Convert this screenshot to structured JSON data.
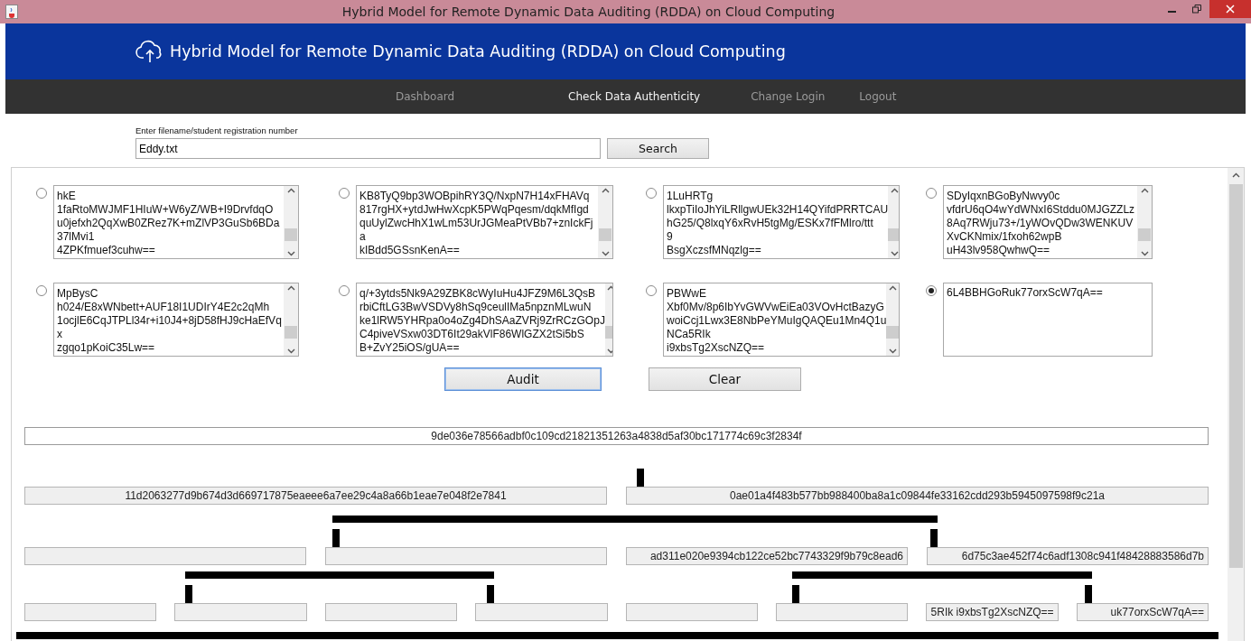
{
  "window": {
    "title": "Hybrid Model for Remote Dynamic Data Auditing (RDDA) on Cloud Computing"
  },
  "header": {
    "title": "Hybrid Model for Remote Dynamic Data Auditing (RDDA) on Cloud Computing"
  },
  "nav": [
    {
      "label": "Dashboard",
      "selected": false
    },
    {
      "label": "Check Data Authenticity",
      "selected": true
    },
    {
      "label": "Change Login",
      "selected": false
    },
    {
      "label": "Logout",
      "selected": false
    }
  ],
  "search": {
    "label": "Enter filename/student registration number",
    "value": "Eddy.txt",
    "button": "Search"
  },
  "blocks": [
    {
      "selected": false,
      "scrollable": true,
      "lines": [
        "hkE",
        "1faRtoMWJMF1HIuW+W6yZ/WB+I9DrvfdqO",
        "u0jefxh2QqXwB0ZRez7K+mZlVP3GuSb6BDa",
        "37lMvi1",
        "4ZPKfmuef3cuhw=="
      ]
    },
    {
      "selected": false,
      "scrollable": true,
      "lines": [
        "KB8TyQ9bp3WOBpihRY3Q/NxpN7H14xFHAVq",
        "817rgHX+ytdJwHwXcpK5PWqPqesm/dqkMfIgd",
        "quUylZwcHhX1wLm53UrJGMeaPtVBb7+znIckFj",
        "a",
        "kIBdd5GSsnKenA=="
      ]
    },
    {
      "selected": false,
      "scrollable": true,
      "lines": [
        "1LuHRTg",
        "lkxpTiIoJhYiLRllgwUEk32H14QYifdPRRTCAU",
        "hG25/Q8lxqY6xRvH5tgMg/ESKx7fFMlro/ttt",
        "9",
        "BsgXczsfMNqzlg=="
      ]
    },
    {
      "selected": false,
      "scrollable": true,
      "lines": [
        "SDyIqxnBGoByNwvy0c",
        "vfdrU6qO4wYdWNxI6Stddu0MJGZZLz",
        "8Aq7RWju73+/1yWOvQDw3WENKUV",
        "XvCKNmix/1fxoh62wpB",
        "uH43lv958QwhwQ=="
      ]
    },
    {
      "selected": false,
      "scrollable": true,
      "lines": [
        "MpBysC",
        "h024/E8xWNbett+AUF18I1UDIrY4E2c2qMh",
        "1ocjlE6CqJTPLl34r+i10J4+8jD58fHJ9cHaEfVq",
        "x",
        "zgqo1pKoiC35Lw=="
      ]
    },
    {
      "selected": false,
      "scrollable": true,
      "lines": [
        "q/+3ytds5Nk9A29ZBK8cWyIuHu4JFZ9M6L3QsB",
        "rbiCftLG3BwVSDVy8hSq9ceulIMa5npznMLwuN",
        "ke1lRW5YHRpa0o4oZg4DhSAaZVRj9ZrRCzGOpJ",
        "C4piveVSxw03DT6It29akVlF86WlGZX2tSi5bS",
        "B+ZvY25iOS/gUA=="
      ]
    },
    {
      "selected": false,
      "scrollable": true,
      "lines": [
        "PBWwE",
        "Xbf0Mv/8p6IbYvGWVwEiEa03VOvHctBazyG",
        "woiCcj1Lwx3E8NbPeYMuIgQAQEu1Mn4Q1u",
        "NCa5RIk",
        "i9xbsTg2XscNZQ=="
      ]
    },
    {
      "selected": true,
      "scrollable": false,
      "lines": [
        "6L4BBHGoRuk77orxScW7qA=="
      ]
    }
  ],
  "actions": [
    {
      "label": "Audit",
      "focused": true
    },
    {
      "label": "Clear",
      "focused": false
    }
  ],
  "tree": [
    [
      {
        "value": "9de036e78566adbf0c109cd21821351263a4838d5af30bc171774c69c3f2834f"
      }
    ],
    [
      {
        "value": "11d2063277d9b674d3d669717875eaeee6a7ee29c4a8a66b1eae7e048f2e7841"
      },
      {
        "value": "0ae01a4f483b577bb988400ba8a1c09844fe33162cdd293b5945097598f9c21a"
      }
    ],
    [
      {
        "kind": "blank"
      },
      {
        "kind": "blank"
      },
      {
        "value": "ad311e020e9394cb122ce52bc7743329f9b79c8ead6"
      },
      {
        "value": "6d75c3ae452f74c6adf1308c941f48428883586d7b"
      }
    ],
    [
      {
        "kind": "blank"
      },
      {
        "kind": "blank"
      },
      {
        "kind": "blank"
      },
      {
        "kind": "blank"
      },
      {
        "kind": "blank"
      },
      {
        "kind": "blank"
      },
      {
        "value": "5RIk i9xbsTg2XscNZQ=="
      },
      {
        "value": "uk77orxScW7qA=="
      }
    ]
  ]
}
